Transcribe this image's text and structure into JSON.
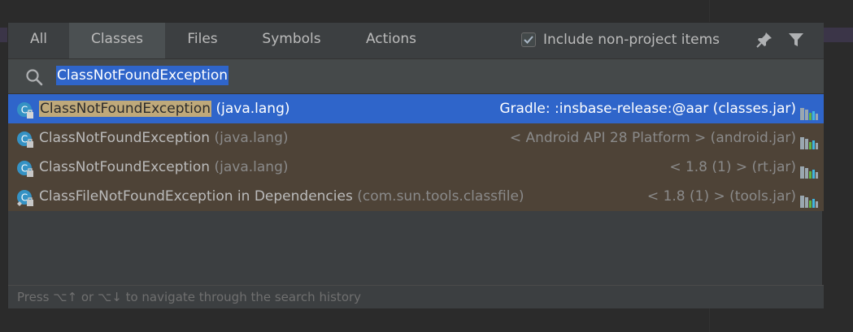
{
  "tabs": [
    {
      "label": "All"
    },
    {
      "label": "Classes"
    },
    {
      "label": "Files"
    },
    {
      "label": "Symbols"
    },
    {
      "label": "Actions"
    }
  ],
  "active_tab": "Classes",
  "include_non_project": {
    "label": "Include non-project items",
    "checked": true
  },
  "toolbar_icons": [
    "pin-icon",
    "filter-icon"
  ],
  "search": {
    "value": "ClassNotFoundException",
    "icon": "search-icon"
  },
  "results": [
    {
      "match": "ClassNotFoundException",
      "rest": "",
      "package": "(java.lang)",
      "location": "Gradle: :insbase-release:@aar (classes.jar)",
      "selected": true
    },
    {
      "match": "",
      "rest": "ClassNotFoundException",
      "package": "(java.lang)",
      "location": "< Android API 28 Platform > (android.jar)",
      "selected": false
    },
    {
      "match": "",
      "rest": "ClassNotFoundException",
      "package": "(java.lang)",
      "location": "< 1.8 (1) > (rt.jar)",
      "selected": false
    },
    {
      "match": "",
      "rest": "ClassFileNotFoundException in Dependencies",
      "package": "(com.sun.tools.classfile)",
      "location": "< 1.8 (1) > (tools.jar)",
      "selected": false
    }
  ],
  "footer": {
    "hint": "Press ⌥↑ or ⌥↓ to navigate through the search history"
  },
  "colors": {
    "selection": "#2f65ca",
    "match_highlight": "#bfa97a",
    "result_bg": "#4e4337",
    "popup_bg": "#3c3f41"
  }
}
